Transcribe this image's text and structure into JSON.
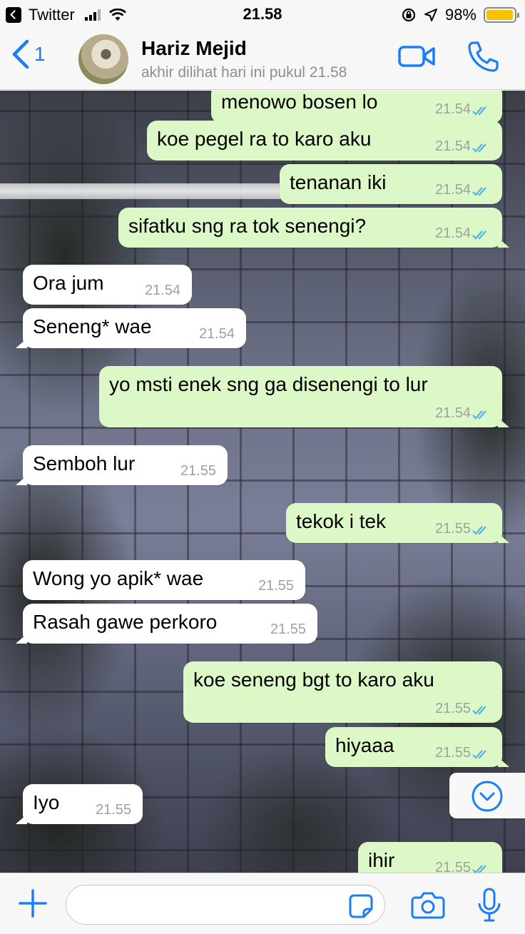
{
  "status_bar": {
    "app": "Twitter",
    "time": "21.58",
    "battery": "98%",
    "battery_level": 0.98
  },
  "header": {
    "back_count": "1",
    "name": "Hariz Mejid",
    "status": "akhir dilihat hari ini pukul 21.58"
  },
  "messages": [
    {
      "dir": "out",
      "text": "menowo bosen lo",
      "time": "21.54",
      "read": true
    },
    {
      "dir": "out",
      "text": "koe pegel ra to karo aku",
      "time": "21.54",
      "read": true
    },
    {
      "dir": "out",
      "text": "tenanan iki",
      "time": "21.54",
      "read": true
    },
    {
      "dir": "out",
      "text": "sifatku sng ra tok senengi?",
      "time": "21.54",
      "read": true
    },
    {
      "dir": "in",
      "text": "Ora jum",
      "time": "21.54"
    },
    {
      "dir": "in",
      "text": "Seneng* wae",
      "time": "21.54"
    },
    {
      "dir": "out",
      "text": "yo msti enek sng ga disenengi to lur",
      "time": "21.54",
      "read": true
    },
    {
      "dir": "in",
      "text": "Semboh lur",
      "time": "21.55"
    },
    {
      "dir": "out",
      "text": "tekok i tek",
      "time": "21.55",
      "read": true
    },
    {
      "dir": "in",
      "text": "Wong yo apik* wae",
      "time": "21.55"
    },
    {
      "dir": "in",
      "text": "Rasah gawe perkoro",
      "time": "21.55"
    },
    {
      "dir": "out",
      "text": "koe seneng bgt to karo aku",
      "time": "21.55",
      "read": true
    },
    {
      "dir": "out",
      "text": "hiyaaa",
      "time": "21.55",
      "read": true
    },
    {
      "dir": "in",
      "text": "Iyo",
      "time": "21.55"
    },
    {
      "dir": "out",
      "text": "ihir",
      "time": "21.55",
      "read": true
    }
  ],
  "input": {
    "value": "",
    "placeholder": ""
  },
  "colors": {
    "accent": "#1a7ff5",
    "outgoing_bubble": "#dcf8c6",
    "incoming_bubble": "#ffffff",
    "read_ticks": "#4fb3e8"
  },
  "icons": [
    "back-chevron-icon",
    "video-camera-icon",
    "phone-icon",
    "double-check-icon",
    "chevron-down-icon",
    "plus-icon",
    "sticker-icon",
    "camera-icon",
    "microphone-icon"
  ]
}
